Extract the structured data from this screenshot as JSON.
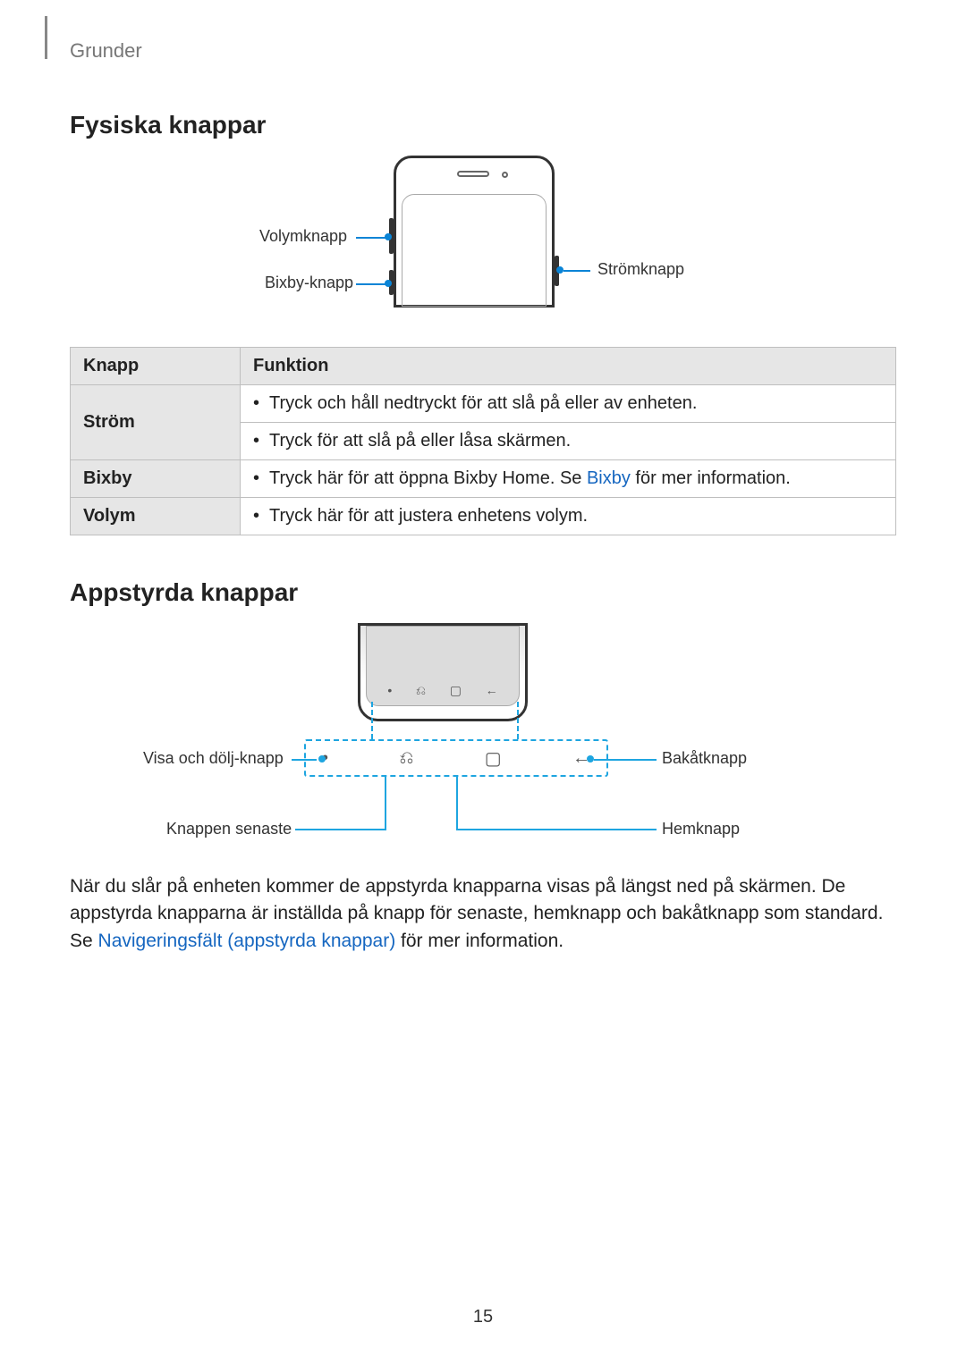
{
  "chapter": "Grunder",
  "section_physical": "Fysiska knappar",
  "callouts_physical": {
    "volume": "Volymknapp",
    "bixby": "Bixby-knapp",
    "power": "Strömknapp"
  },
  "table": {
    "header_key": "Knapp",
    "header_func": "Funktion",
    "rows": [
      {
        "key": "Ström",
        "funcs": [
          "Tryck och håll nedtryckt för att slå på eller av enheten.",
          "Tryck för att slå på eller låsa skärmen."
        ]
      },
      {
        "key": "Bixby",
        "funcs_pre": "Tryck här för att öppna Bixby Home. Se ",
        "funcs_link": "Bixby",
        "funcs_post": " för mer information."
      },
      {
        "key": "Volym",
        "funcs": [
          "Tryck här för att justera enhetens volym."
        ]
      }
    ]
  },
  "section_soft": "Appstyrda knappar",
  "callouts_soft": {
    "showhide": "Visa och dölj-knapp",
    "recent": "Knappen senaste",
    "home": "Hemknapp",
    "back": "Bakåtknapp"
  },
  "soft_para_pre": "När du slår på enheten kommer de appstyrda knapparna visas på längst ned på skärmen. De appstyrda knapparna är inställda på knapp för senaste, hemknapp och bakåtknapp som standard. Se ",
  "soft_para_link": "Navigeringsfält (appstyrda knappar)",
  "soft_para_post": " för mer information.",
  "page_number": "15"
}
